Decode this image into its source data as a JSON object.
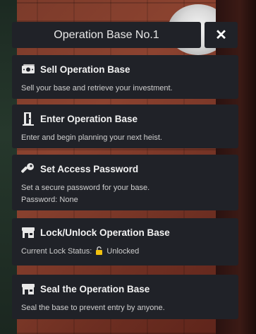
{
  "window": {
    "title": "Operation Base No.1",
    "close_label": "✕"
  },
  "menu": [
    {
      "icon": "money-icon",
      "title": "Sell Operation Base",
      "desc": "Sell your base and retrieve your investment."
    },
    {
      "icon": "door-icon",
      "title": "Enter Operation Base",
      "desc": "Enter and begin planning your next heist."
    },
    {
      "icon": "key-icon",
      "title": "Set Access Password",
      "desc": "Set a secure password for your base.",
      "extra_label": "Password:",
      "extra_value": "None"
    },
    {
      "icon": "shop-icon",
      "title": "Lock/Unlock Operation Base",
      "status_label": "Current Lock Status:",
      "status_value": "Unlocked"
    },
    {
      "icon": "shop-icon",
      "title": "Seal the Operation Base",
      "desc": "Seal the base to prevent entry by anyone."
    }
  ]
}
